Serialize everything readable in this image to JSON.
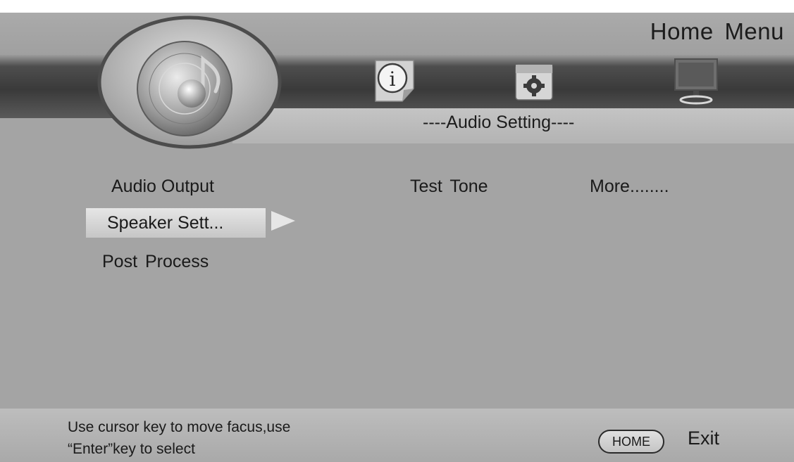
{
  "header": {
    "title": "Home Menu"
  },
  "tabs": [
    {
      "icon": "info-icon"
    },
    {
      "icon": "settings-icon"
    },
    {
      "icon": "monitor-icon"
    }
  ],
  "section": {
    "title": "----Audio Setting----"
  },
  "menu": {
    "items": [
      {
        "label": "Audio Output"
      },
      {
        "label": "Speaker Sett...",
        "selected": true
      },
      {
        "label": "Post  Process"
      }
    ],
    "extra_items": [
      {
        "label": "Test  Tone"
      },
      {
        "label": "More........"
      }
    ]
  },
  "footer": {
    "hint_line1": "Use cursor key to move facus,use",
    "hint_line2": "“Enter”key to select",
    "home_key": "HOME",
    "exit_label": "Exit"
  },
  "colors": {
    "background": "#a4a4a4",
    "band_dark": "#3a3a3a",
    "highlight": "#e6e6e6"
  }
}
